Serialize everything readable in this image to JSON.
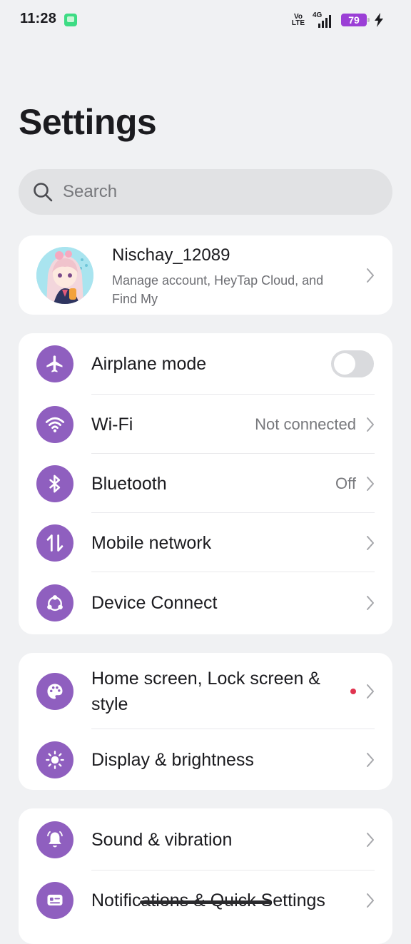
{
  "status_bar": {
    "time": "11:28",
    "volte": [
      "Vo",
      "LTE"
    ],
    "network": "4G",
    "battery": "79"
  },
  "title": "Settings",
  "search": {
    "placeholder": "Search"
  },
  "account": {
    "name": "Nischay_12089",
    "description": "Manage account, HeyTap Cloud, and Find My"
  },
  "groups": {
    "connectivity": [
      {
        "label": "Airplane mode",
        "icon": "airplane-icon",
        "toggle": false
      },
      {
        "label": "Wi-Fi",
        "icon": "wifi-icon",
        "value": "Not connected"
      },
      {
        "label": "Bluetooth",
        "icon": "bluetooth-icon",
        "value": "Off"
      },
      {
        "label": "Mobile network",
        "icon": "mobile-network-icon"
      },
      {
        "label": "Device Connect",
        "icon": "device-connect-icon"
      }
    ],
    "personalization": [
      {
        "label": "Home screen, Lock screen & style",
        "icon": "palette-icon",
        "badge": "red-dot"
      },
      {
        "label": "Display & brightness",
        "icon": "brightness-icon"
      }
    ],
    "sound": [
      {
        "label": "Sound & vibration",
        "icon": "bell-icon"
      },
      {
        "label": "Notifications & Quick Settings",
        "icon": "notification-icon"
      }
    ]
  },
  "colors": {
    "accent": "#8f5fbf",
    "battery": "#9b3fd6",
    "badge": "#e0334f",
    "background": "#f0f1f3"
  }
}
